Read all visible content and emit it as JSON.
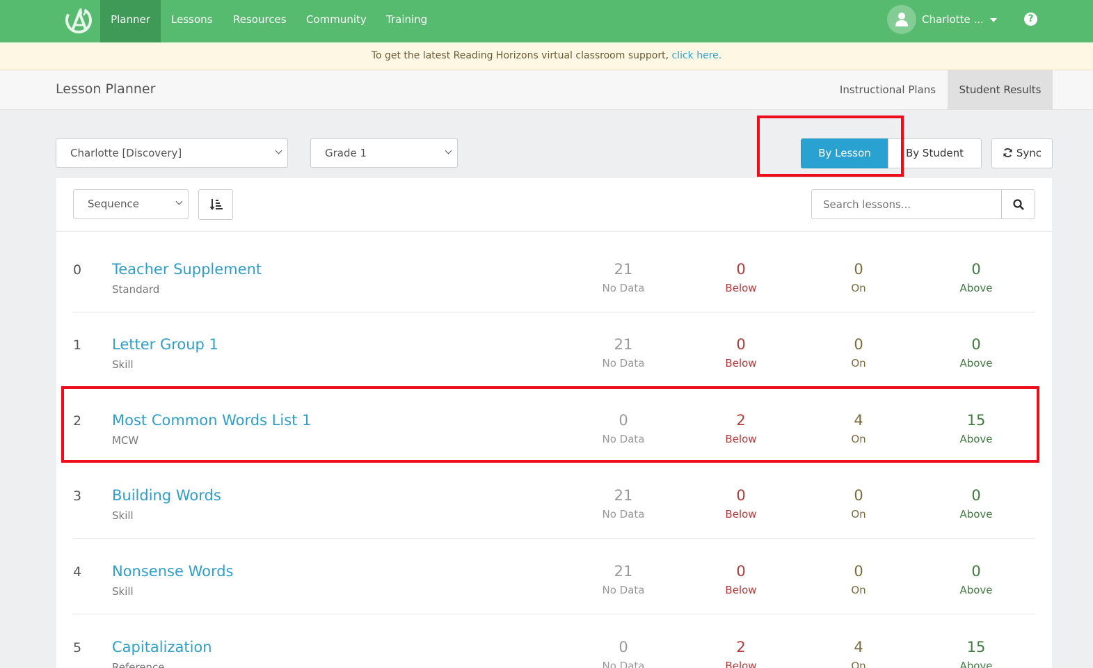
{
  "nav": {
    "items": [
      "Planner",
      "Lessons",
      "Resources",
      "Community",
      "Training"
    ],
    "active": "Planner",
    "user_name": "Charlotte ...",
    "help_symbol": "?"
  },
  "banner": {
    "text": "To get the latest Reading Horizons virtual classroom support,",
    "link": "click here."
  },
  "subheader": {
    "title": "Lesson Planner",
    "tabs": [
      "Instructional Plans",
      "Student Results"
    ],
    "active_tab": "Student Results"
  },
  "filters": {
    "school": "Charlotte [Discovery]",
    "grade": "Grade 1",
    "view_by_lesson": "By Lesson",
    "view_by_student": "By Student",
    "sync": "Sync"
  },
  "toolbar": {
    "sort": "Sequence",
    "search_placeholder": "Search lessons..."
  },
  "stat_labels": {
    "no_data": "No Data",
    "below": "Below",
    "on": "On",
    "above": "Above"
  },
  "lessons": [
    {
      "index": "0",
      "title": "Teacher Supplement",
      "type": "Standard",
      "no_data": "21",
      "below": "0",
      "on": "0",
      "above": "0"
    },
    {
      "index": "1",
      "title": "Letter Group 1",
      "type": "Skill",
      "no_data": "21",
      "below": "0",
      "on": "0",
      "above": "0"
    },
    {
      "index": "2",
      "title": "Most Common Words List 1",
      "type": "MCW",
      "no_data": "0",
      "below": "2",
      "on": "4",
      "above": "15"
    },
    {
      "index": "3",
      "title": "Building Words",
      "type": "Skill",
      "no_data": "21",
      "below": "0",
      "on": "0",
      "above": "0"
    },
    {
      "index": "4",
      "title": "Nonsense Words",
      "type": "Skill",
      "no_data": "21",
      "below": "0",
      "on": "0",
      "above": "0"
    },
    {
      "index": "5",
      "title": "Capitalization",
      "type": "Reference",
      "no_data": "0",
      "below": "2",
      "on": "4",
      "above": "15"
    }
  ],
  "colors": {
    "nav_green": "#56bb6f",
    "link_blue": "#2e9ecb",
    "primary_button": "#2aa2d1",
    "highlight_red": "#ee0d1b"
  }
}
